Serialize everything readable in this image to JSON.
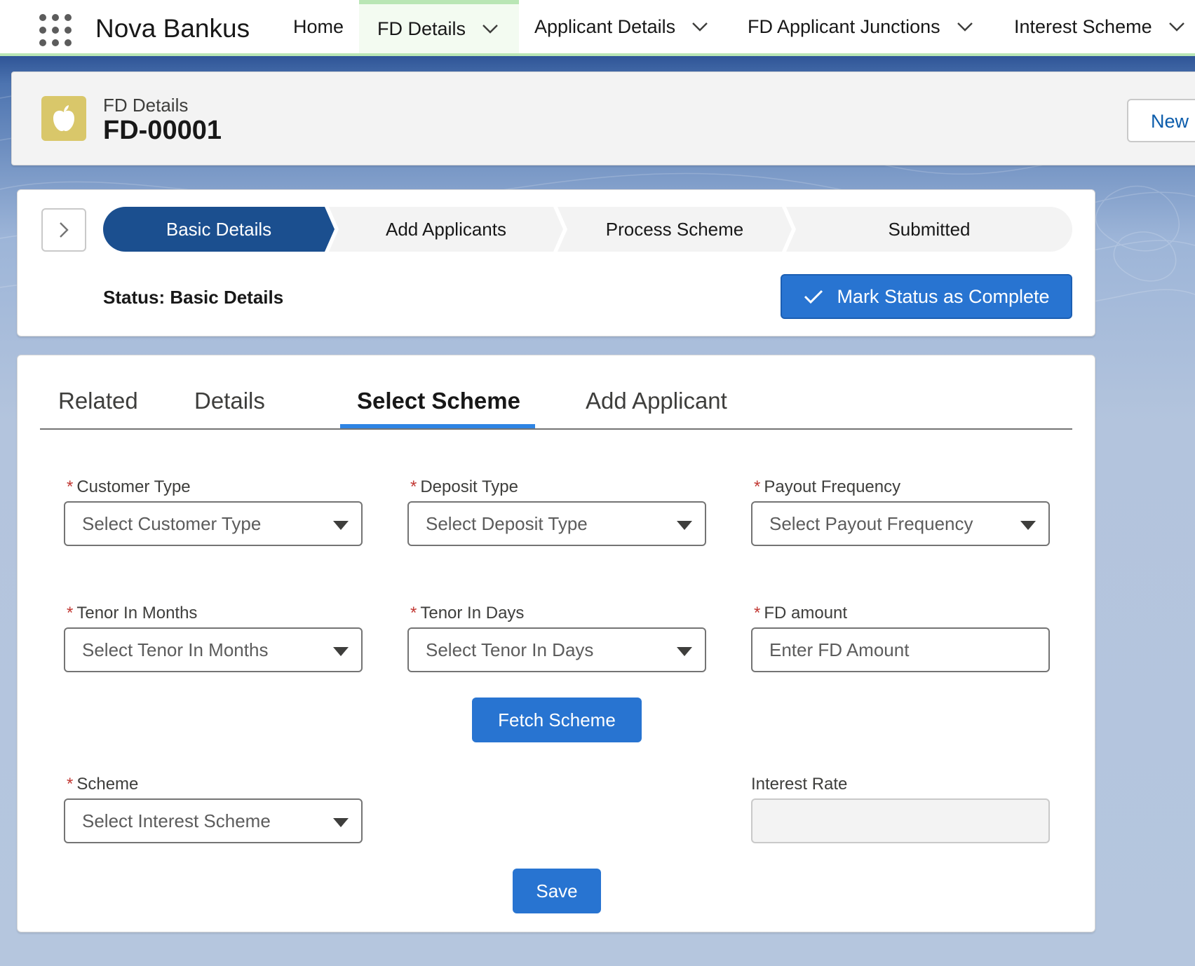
{
  "app": {
    "name": "Nova Bankus",
    "icon": "app-launcher-icon"
  },
  "nav": {
    "items": [
      {
        "label": "Home",
        "has_menu": false,
        "active": false
      },
      {
        "label": "FD Details",
        "has_menu": true,
        "active": true
      },
      {
        "label": "Applicant Details",
        "has_menu": true,
        "active": false
      },
      {
        "label": "FD Applicant Junctions",
        "has_menu": true,
        "active": false
      },
      {
        "label": "Interest Scheme",
        "has_menu": true,
        "active": false
      }
    ],
    "accent_color": "#b9e6b5"
  },
  "record": {
    "object_label": "FD Details",
    "name": "FD-00001",
    "icon": "apple-icon",
    "icon_color": "#d9c76a",
    "new_button_label": "New"
  },
  "path": {
    "stages": [
      "Basic Details",
      "Add Applicants",
      "Process Scheme",
      "Submitted"
    ],
    "current_stage": "Basic Details",
    "status_text": "Status: Basic Details",
    "complete_button_label": "Mark Status as Complete",
    "current_color": "#1b4f8f"
  },
  "tabs": {
    "items": [
      "Related",
      "Details",
      "Select Scheme",
      "Add Applicant"
    ],
    "active": "Select Scheme",
    "underline_color": "#2e84e4"
  },
  "form": {
    "customer_type": {
      "label": "Customer Type",
      "required": true,
      "placeholder": "Select Customer Type"
    },
    "deposit_type": {
      "label": "Deposit Type",
      "required": true,
      "placeholder": "Select Deposit Type"
    },
    "payout_frequency": {
      "label": "Payout Frequency",
      "required": true,
      "placeholder": "Select Payout Frequency"
    },
    "tenor_months": {
      "label": "Tenor In Months",
      "required": true,
      "placeholder": "Select Tenor In Months"
    },
    "tenor_days": {
      "label": "Tenor In Days",
      "required": true,
      "placeholder": "Select Tenor In Days"
    },
    "fd_amount": {
      "label": "FD amount",
      "required": true,
      "placeholder": "Enter FD Amount",
      "value": ""
    },
    "fetch_button_label": "Fetch Scheme",
    "scheme": {
      "label": "Scheme",
      "required": true,
      "placeholder": "Select Interest Scheme"
    },
    "interest_rate": {
      "label": "Interest Rate",
      "value": ""
    },
    "save_button_label": "Save",
    "required_marker": "*"
  },
  "colors": {
    "brand_button": "#2874d1",
    "link": "#0b5cab",
    "required": "#c23934"
  }
}
